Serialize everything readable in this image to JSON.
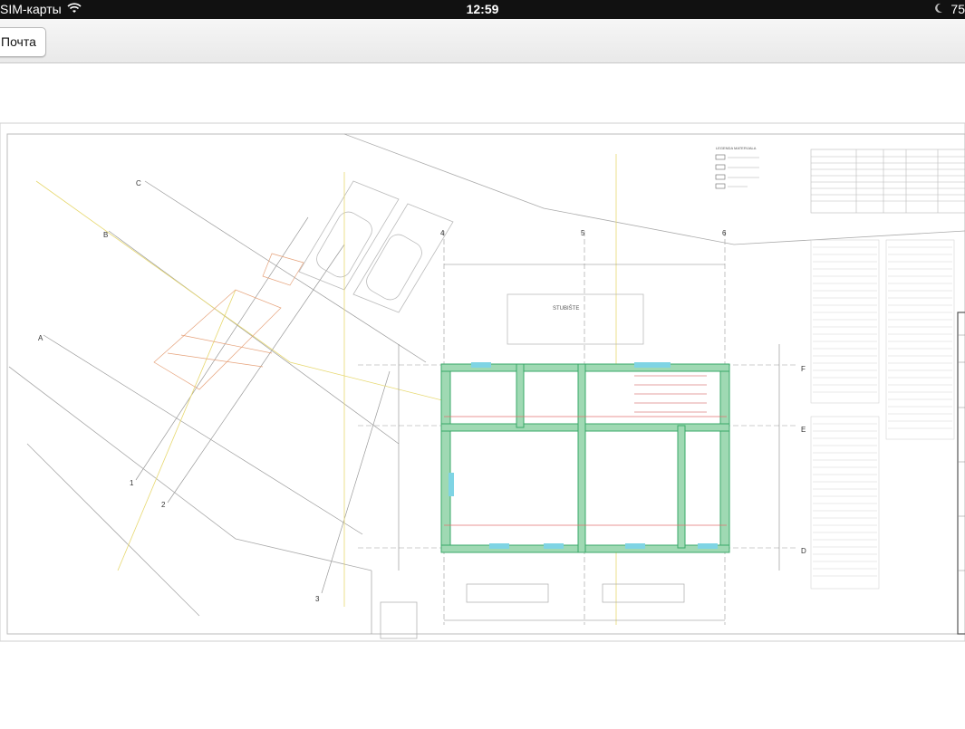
{
  "status_bar": {
    "carrier": "SIM-карты",
    "time": "12:59",
    "battery": "75",
    "wifi_icon": "wifi-icon",
    "moon_icon": "moon-icon"
  },
  "toolbar": {
    "back_label": "Почта"
  },
  "drawing": {
    "grid_axes_top": [
      "4",
      "5",
      "6"
    ],
    "grid_axes_right": [
      "F",
      "E",
      "D"
    ],
    "grid_axes_left": [
      "C",
      "B",
      "A"
    ],
    "grid_axes_bottom_left": [
      "1",
      "2",
      "3"
    ],
    "legend_title": "LEGENDA MATERIJALA",
    "room_top": "STUBIŠTE"
  }
}
